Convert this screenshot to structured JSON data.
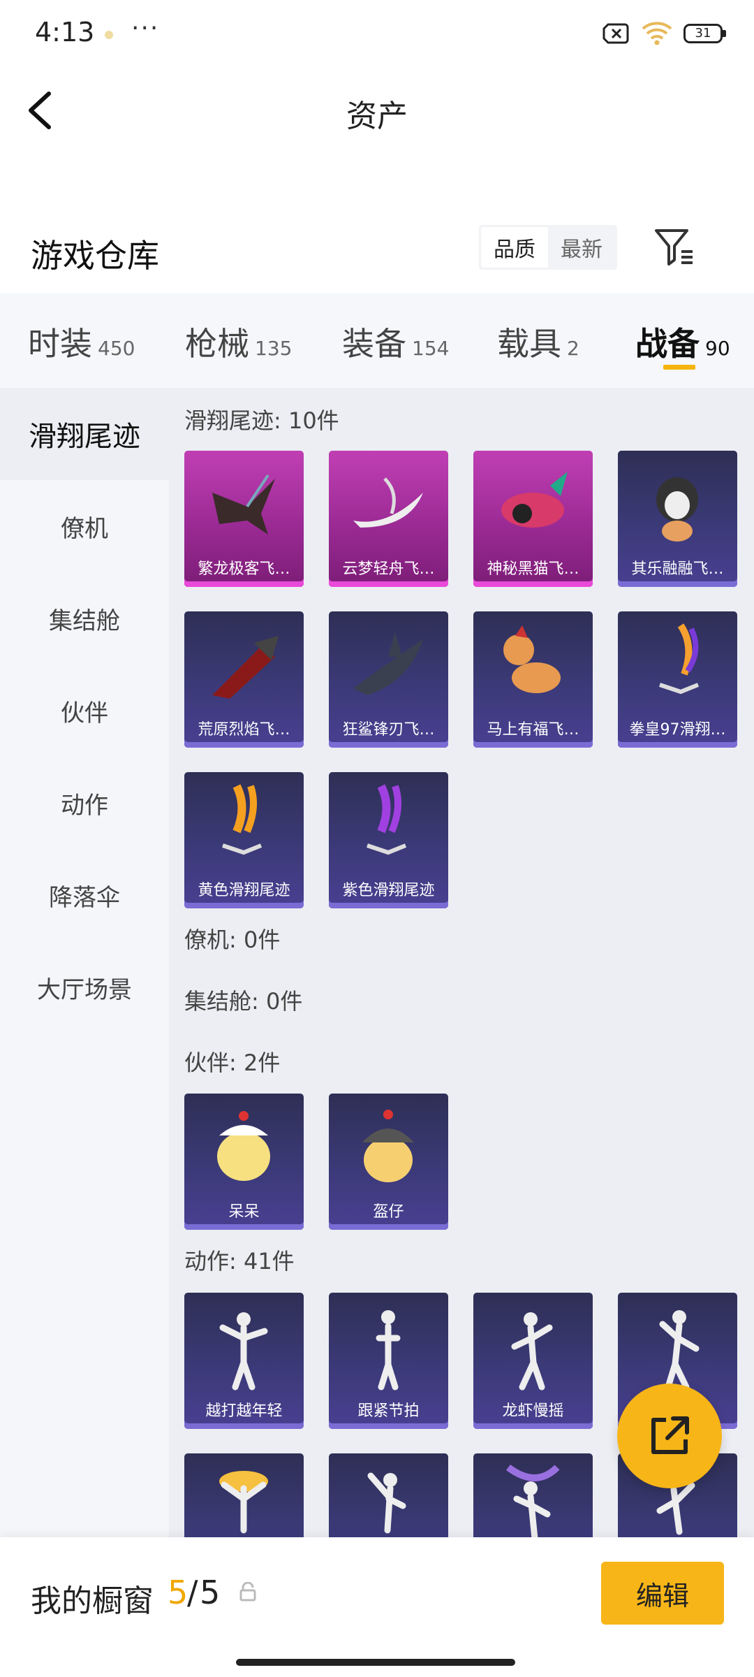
{
  "status": {
    "time": "4:13",
    "more": "···",
    "battery": "31"
  },
  "header": {
    "title": "资产"
  },
  "warehouse": {
    "title": "游戏仓库",
    "sort": [
      "品质",
      "最新"
    ]
  },
  "tabs": [
    {
      "label": "时装",
      "count": "450"
    },
    {
      "label": "枪械",
      "count": "135"
    },
    {
      "label": "装备",
      "count": "154"
    },
    {
      "label": "载具",
      "count": "2"
    },
    {
      "label": "战备",
      "count": "90"
    }
  ],
  "sidebar": [
    "滑翔尾迹",
    "僚机",
    "集结舱",
    "伙伴",
    "动作",
    "降落伞",
    "大厅场景"
  ],
  "groups": {
    "g1": "滑翔尾迹: 10件",
    "g2": "僚机: 0件",
    "g3": "集结舱: 0件",
    "g4": "伙伴: 2件",
    "g5": "动作: 41件"
  },
  "items": [
    "繁龙极客飞…",
    "云梦轻舟飞…",
    "神秘黑猫飞…",
    "其乐融融飞…",
    "荒原烈焰飞…",
    "狂鲨锋刃飞…",
    "马上有福飞…",
    "拳皇97滑翔…",
    "黄色滑翔尾迹",
    "紫色滑翔尾迹",
    "呆呆",
    "盔仔",
    "越打越年轻",
    "跟紧节拍",
    "龙虾慢摇"
  ],
  "showcase": {
    "label": "我的橱窗",
    "count": "5",
    "slash": "/",
    "total": "5"
  },
  "bottom": {
    "edit": "编辑"
  },
  "colors": {
    "accent": "#f7b518",
    "tile_blue": "#3b3a78",
    "tile_pink": "#c03fb4"
  }
}
